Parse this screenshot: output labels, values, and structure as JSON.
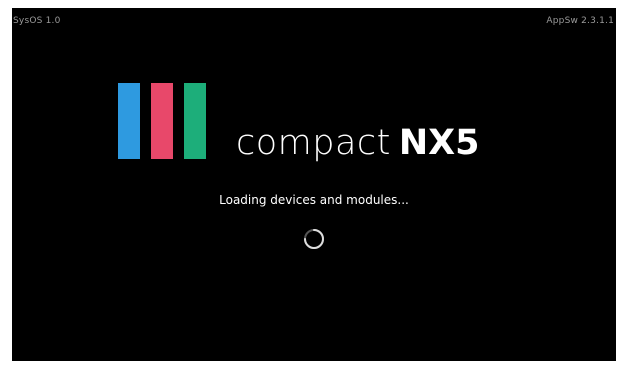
{
  "header": {
    "sysos_version": "SysOS 1.0",
    "app_version": "AppSw 2.3.1.1"
  },
  "logo": {
    "bars": [
      {
        "name": "blue",
        "color": "#2E9AE0"
      },
      {
        "name": "red",
        "color": "#E8486A"
      },
      {
        "name": "green",
        "color": "#1DAE7A"
      }
    ]
  },
  "product": {
    "name_light": "compact",
    "name_bold": "NX5"
  },
  "status": {
    "message": "Loading devices and modules...",
    "spinner_icon": "loading-spinner-icon"
  },
  "colors": {
    "background": "#000000",
    "text": "#FFFFFF",
    "corner_text": "#9A9A9A"
  }
}
